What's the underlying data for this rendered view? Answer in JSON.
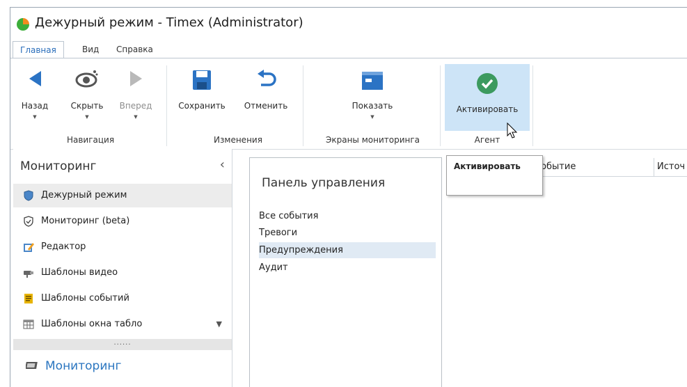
{
  "window": {
    "title": "Дежурный режим - Timex (Administrator)"
  },
  "tabs": [
    {
      "label": "Главная",
      "active": true
    },
    {
      "label": "Вид",
      "active": false
    },
    {
      "label": "Справка",
      "active": false
    }
  ],
  "ribbon": {
    "navigation": {
      "back": "Назад",
      "hide": "Скрыть",
      "forward": "Вперед",
      "group": "Навигация"
    },
    "changes": {
      "save": "Сохранить",
      "cancel": "Отменить",
      "group": "Изменения"
    },
    "screens": {
      "show": "Показать",
      "group": "Экраны мониторинга"
    },
    "agent": {
      "activate": "Активировать",
      "group": "Агент"
    }
  },
  "sidebar": {
    "header": "Мониторинг",
    "collapse_glyph": "‹",
    "items": [
      {
        "label": "Дежурный режим",
        "icon": "shield-icon",
        "selected": true
      },
      {
        "label": "Мониторинг (beta)",
        "icon": "shield-check-icon",
        "selected": false
      },
      {
        "label": "Редактор",
        "icon": "edit-icon",
        "selected": false
      },
      {
        "label": "Шаблоны видео",
        "icon": "camera-icon",
        "selected": false
      },
      {
        "label": "Шаблоны событий",
        "icon": "document-icon",
        "selected": false
      },
      {
        "label": "Шаблоны окна табло",
        "icon": "table-icon",
        "selected": false
      }
    ],
    "more_glyph": "▼",
    "splitter_glyph": "......",
    "bottom_section": "Мониторинг"
  },
  "control_panel": {
    "title": "Панель управления",
    "items": [
      {
        "label": "Все события",
        "selected": false
      },
      {
        "label": "Тревоги",
        "selected": false
      },
      {
        "label": "Предупреждения",
        "selected": true
      },
      {
        "label": "Аудит",
        "selected": false
      }
    ]
  },
  "events_table": {
    "columns": [
      "Событие",
      "Источ"
    ]
  },
  "tooltip": {
    "text": "Активировать"
  },
  "colors": {
    "accent": "#2a6ebb",
    "hover": "#cde4f7",
    "arrow_blue": "#2b73c4",
    "activate_green": "#3c9a5f"
  }
}
